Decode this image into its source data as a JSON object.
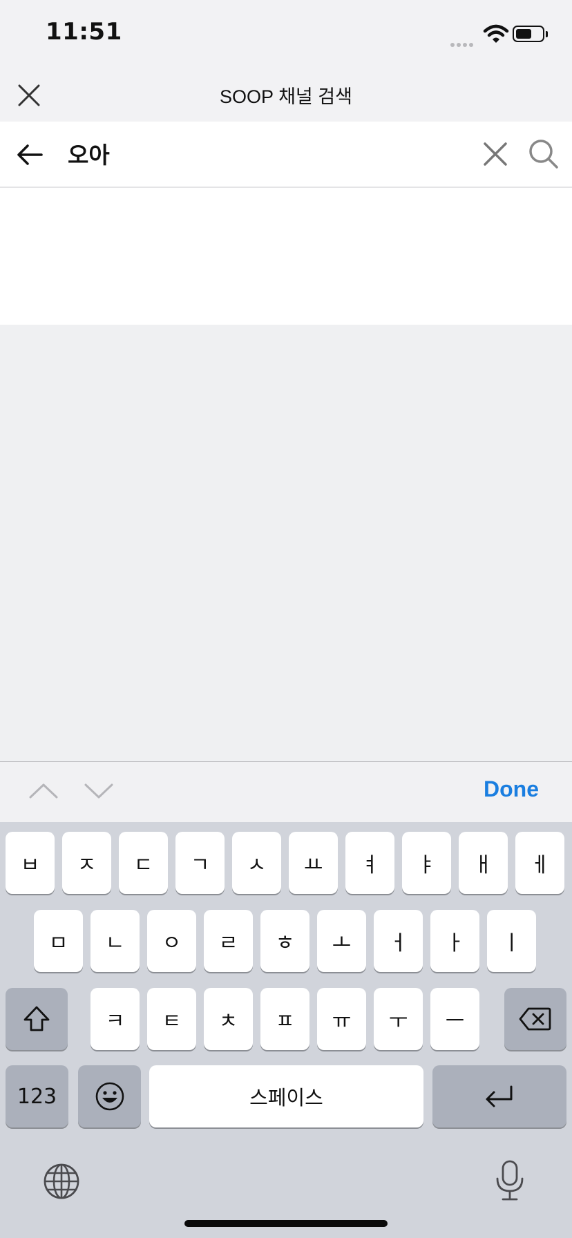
{
  "status_bar": {
    "time": "11:51"
  },
  "header": {
    "title": "SOOP 채널 검색"
  },
  "search": {
    "value": "오아"
  },
  "accessory": {
    "done_label": "Done"
  },
  "keyboard": {
    "row1": [
      "ㅂ",
      "ㅈ",
      "ㄷ",
      "ㄱ",
      "ㅅ",
      "ㅛ",
      "ㅕ",
      "ㅑ",
      "ㅐ",
      "ㅔ"
    ],
    "row2": [
      "ㅁ",
      "ㄴ",
      "ㅇ",
      "ㄹ",
      "ㅎ",
      "ㅗ",
      "ㅓ",
      "ㅏ",
      "ㅣ"
    ],
    "row3": [
      "ㅋ",
      "ㅌ",
      "ㅊ",
      "ㅍ",
      "ㅠ",
      "ㅜ",
      "ㅡ"
    ],
    "numbers_label": "123",
    "space_label": "스페이스"
  },
  "icons": {
    "close": "close-icon",
    "back": "arrow-left-icon",
    "clear": "clear-x-icon",
    "search": "search-icon",
    "shift": "shift-icon",
    "delete": "backspace-icon",
    "emoji": "emoji-icon",
    "return": "return-icon",
    "globe": "globe-icon",
    "mic": "microphone-icon"
  },
  "colors": {
    "accent": "#1a7ee0",
    "caret": "#1a8bff"
  }
}
